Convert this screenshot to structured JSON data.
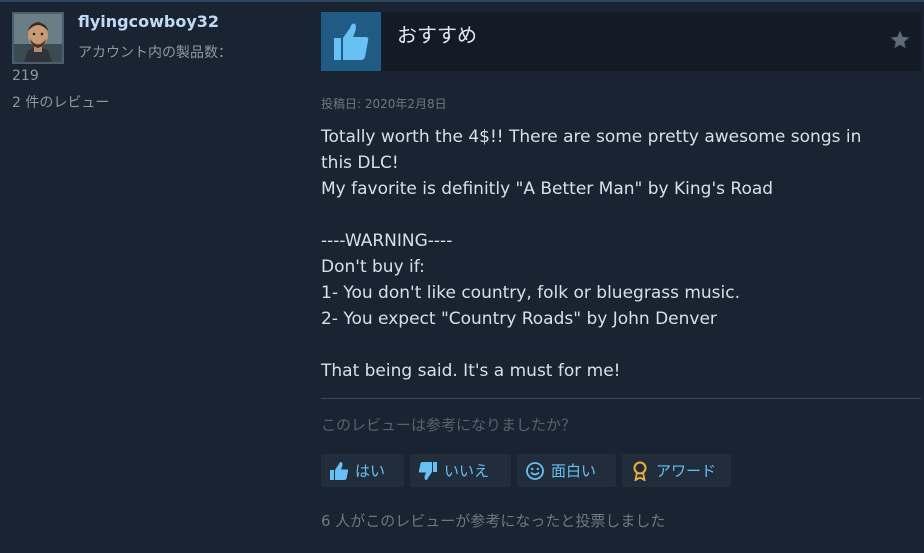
{
  "user": {
    "name": "flyingcowboy32",
    "products_label": "アカウント内の製品数：",
    "products_count": "219",
    "reviews_count": "2 件のレビュー"
  },
  "review": {
    "recommendation": "おすすめ",
    "posted": "投稿日: 2020年2月8日",
    "body_lines": [
      "Totally worth the 4$!! There are some pretty awesome songs in",
      "this DLC!",
      "My favorite is definitly \"A Better Man\" by King's Road",
      "",
      "----WARNING----",
      "Don't buy if:",
      "1- You don't like country, folk or bluegrass music.",
      "2- You expect \"Country Roads\" by John Denver",
      "",
      "That being said. It's a must for me!"
    ],
    "helpful_question": "このレビューは参考になりましたか？",
    "buttons": {
      "yes": "はい",
      "no": "いいえ",
      "funny": "面白い",
      "award": "アワード"
    },
    "tally": "6 人がこのレビューが参考になったと投票しました"
  },
  "colors": {
    "background": "#1a2332",
    "accent": "#66c0f4",
    "thumb_box": "#1f5b85"
  }
}
